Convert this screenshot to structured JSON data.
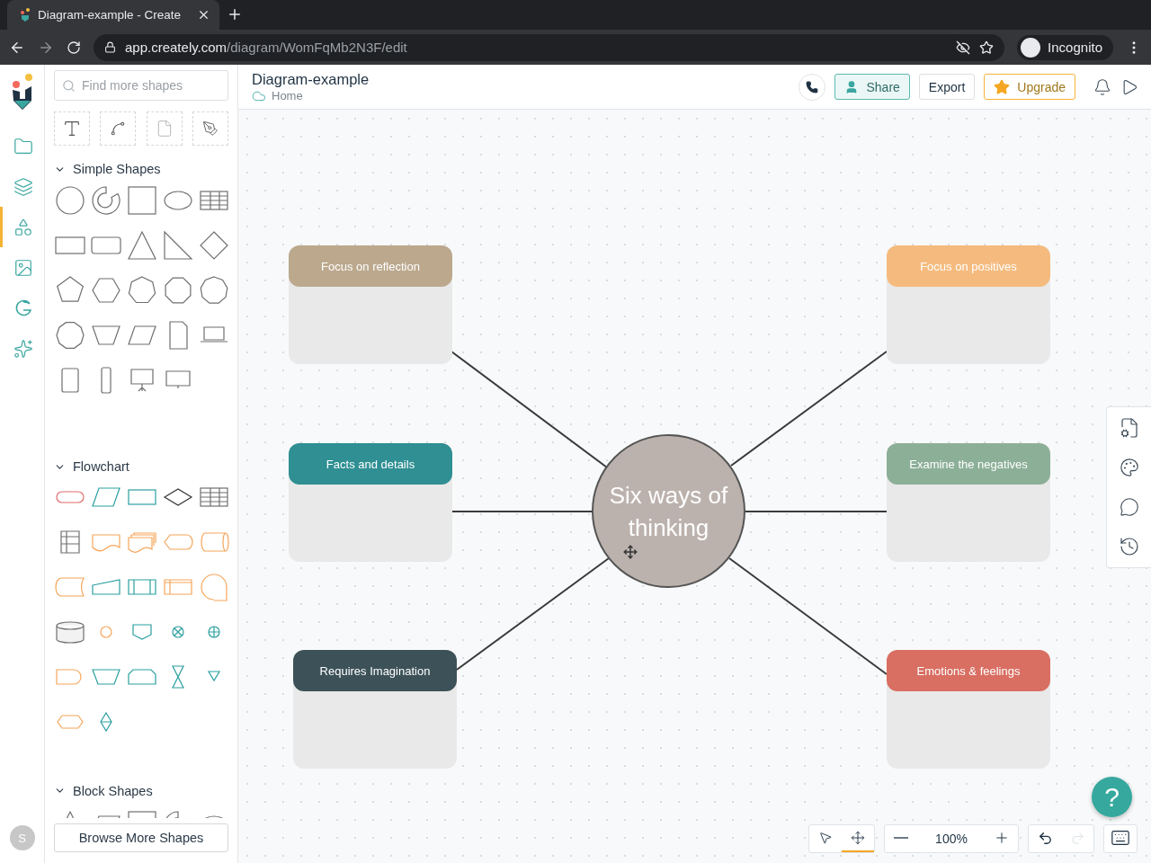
{
  "browser": {
    "tab_title": "Diagram-example - Create",
    "url_host": "app.creately.com",
    "url_path": "/diagram/WomFqMb2N3F/edit",
    "profile": "Incognito"
  },
  "rail": [
    {
      "selected": false
    },
    {
      "selected": false
    },
    {
      "selected": true
    },
    {
      "selected": false
    },
    {
      "selected": false
    },
    {
      "selected": false
    }
  ],
  "avatar": "S",
  "shapes_panel": {
    "search": {
      "placeholder": "Find more shapes"
    },
    "sections": [
      {
        "title": "Simple Shapes",
        "expanded": true
      },
      {
        "title": "Flowchart",
        "expanded": true
      },
      {
        "title": "Block Shapes",
        "expanded": true
      }
    ],
    "browse_button": "Browse More Shapes"
  },
  "header": {
    "title": "Diagram-example",
    "breadcrumb": "Home",
    "share": "Share",
    "export": "Export",
    "upgrade": "Upgrade"
  },
  "diagram": {
    "center": "Six ways of thinking",
    "cards": [
      {
        "title": "Focus on reflection",
        "color": "#bba88d"
      },
      {
        "title": "Focus on positives",
        "color": "#f5bb7e"
      },
      {
        "title": "Facts and details",
        "color": "#2f8f93"
      },
      {
        "title": "Examine the negatives",
        "color": "#8caf98"
      },
      {
        "title": "Requires Imagination",
        "color": "#3c5258"
      },
      {
        "title": "Emotions & feelings",
        "color": "#d96e62"
      }
    ]
  },
  "help": "?",
  "tools": [
    {
      "kind": "select",
      "selected": false
    },
    {
      "kind": "pan",
      "selected": true
    }
  ],
  "zoom": "100%",
  "history": [
    {
      "kind": "undo",
      "disabled": false
    },
    {
      "kind": "redo",
      "disabled": true
    }
  ]
}
